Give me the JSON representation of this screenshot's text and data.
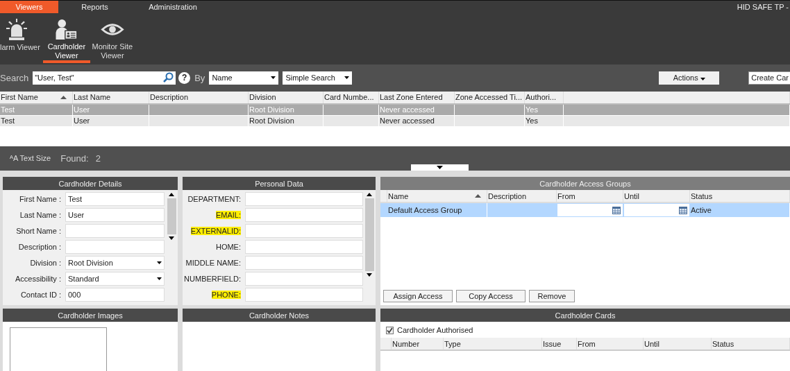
{
  "menu_tabs": [
    {
      "label": "Viewers",
      "selected": true
    },
    {
      "label": "Reports",
      "selected": false
    },
    {
      "label": "Administration",
      "selected": false
    }
  ],
  "app_title": "HID SAFE TP -",
  "ribbon": [
    {
      "label": "larm Viewer",
      "kind": "alarm",
      "selected": false
    },
    {
      "label": "Cardholder Viewer",
      "kind": "cardholder",
      "selected": true
    },
    {
      "label": "Monitor Site Viewer",
      "kind": "eye",
      "selected": false
    }
  ],
  "search": {
    "label": "Search",
    "value": "\"User, Test\"",
    "help": "?",
    "by_label": "By",
    "by_value": "Name",
    "mode": "Simple Search",
    "actions": "Actions",
    "create": "Create Car"
  },
  "results": {
    "columns": [
      {
        "label": "First Name",
        "sorted": true
      },
      {
        "label": "Last Name",
        "sorted": false
      },
      {
        "label": "Description",
        "sorted": false
      },
      {
        "label": "Division",
        "sorted": false
      },
      {
        "label": "Card Numbe...",
        "sorted": false
      },
      {
        "label": "Last Zone Entered",
        "sorted": false
      },
      {
        "label": "Zone Accessed Ti...",
        "sorted": false
      },
      {
        "label": "Authori...",
        "sorted": false
      }
    ],
    "rows": [
      {
        "selected": true,
        "cells": [
          "Test",
          "User",
          "",
          "Root Division",
          "",
          "Never accessed",
          "",
          "Yes"
        ]
      },
      {
        "selected": false,
        "cells": [
          "Test",
          "User",
          "",
          "Root Division",
          "",
          "Never accessed",
          "",
          "Yes"
        ]
      }
    ]
  },
  "status_bar": {
    "text_size_icon": "ᴬA",
    "text_size": "Text Size",
    "found_label": "Found:",
    "found_count": "2"
  },
  "details": {
    "title": "Cardholder Details",
    "fields": [
      {
        "label": "First Name :",
        "value": "Test",
        "kind": "text"
      },
      {
        "label": "Last Name :",
        "value": "User",
        "kind": "text"
      },
      {
        "label": "Short Name :",
        "kind": "text"
      },
      {
        "label": "Description :",
        "kind": "text"
      },
      {
        "label": "Division :",
        "value": "Root Division",
        "kind": "select"
      },
      {
        "label": "Accessibility :",
        "value": "Standard",
        "kind": "select"
      },
      {
        "label": "Contact ID :",
        "value": "000",
        "kind": "text"
      }
    ]
  },
  "personal": {
    "title": "Personal Data",
    "fields": [
      {
        "label": "DEPARTMENT:",
        "highlighted": false
      },
      {
        "label": "EMAIL:",
        "highlighted": true
      },
      {
        "label": "EXTERNALID:",
        "highlighted": true
      },
      {
        "label": "HOME:",
        "highlighted": false
      },
      {
        "label": "MIDDLE NAME:",
        "highlighted": false
      },
      {
        "label": "NUMBERFIELD:",
        "highlighted": false
      },
      {
        "label": "PHONE:",
        "highlighted": true
      }
    ]
  },
  "access_groups": {
    "title": "Cardholder Access Groups",
    "columns": [
      {
        "label": "Name",
        "sorted": true
      },
      {
        "label": "Description",
        "sorted": false
      },
      {
        "label": "From",
        "sorted": false
      },
      {
        "label": "Until",
        "sorted": false
      },
      {
        "label": "Status",
        "sorted": false
      }
    ],
    "rows": [
      {
        "selected": true,
        "name": "Default Access Group",
        "status": "Active"
      }
    ],
    "buttons": [
      "Assign Access",
      "Copy Access",
      "Remove"
    ]
  },
  "images": {
    "title": "Cardholder Images"
  },
  "notes": {
    "title": "Cardholder Notes"
  },
  "cards": {
    "title": "Cardholder Cards",
    "authorised": {
      "label": "Cardholder Authorised",
      "checked": true
    },
    "columns": [
      "Number",
      "Type",
      "Issue",
      "From",
      "Until",
      "Status"
    ]
  }
}
